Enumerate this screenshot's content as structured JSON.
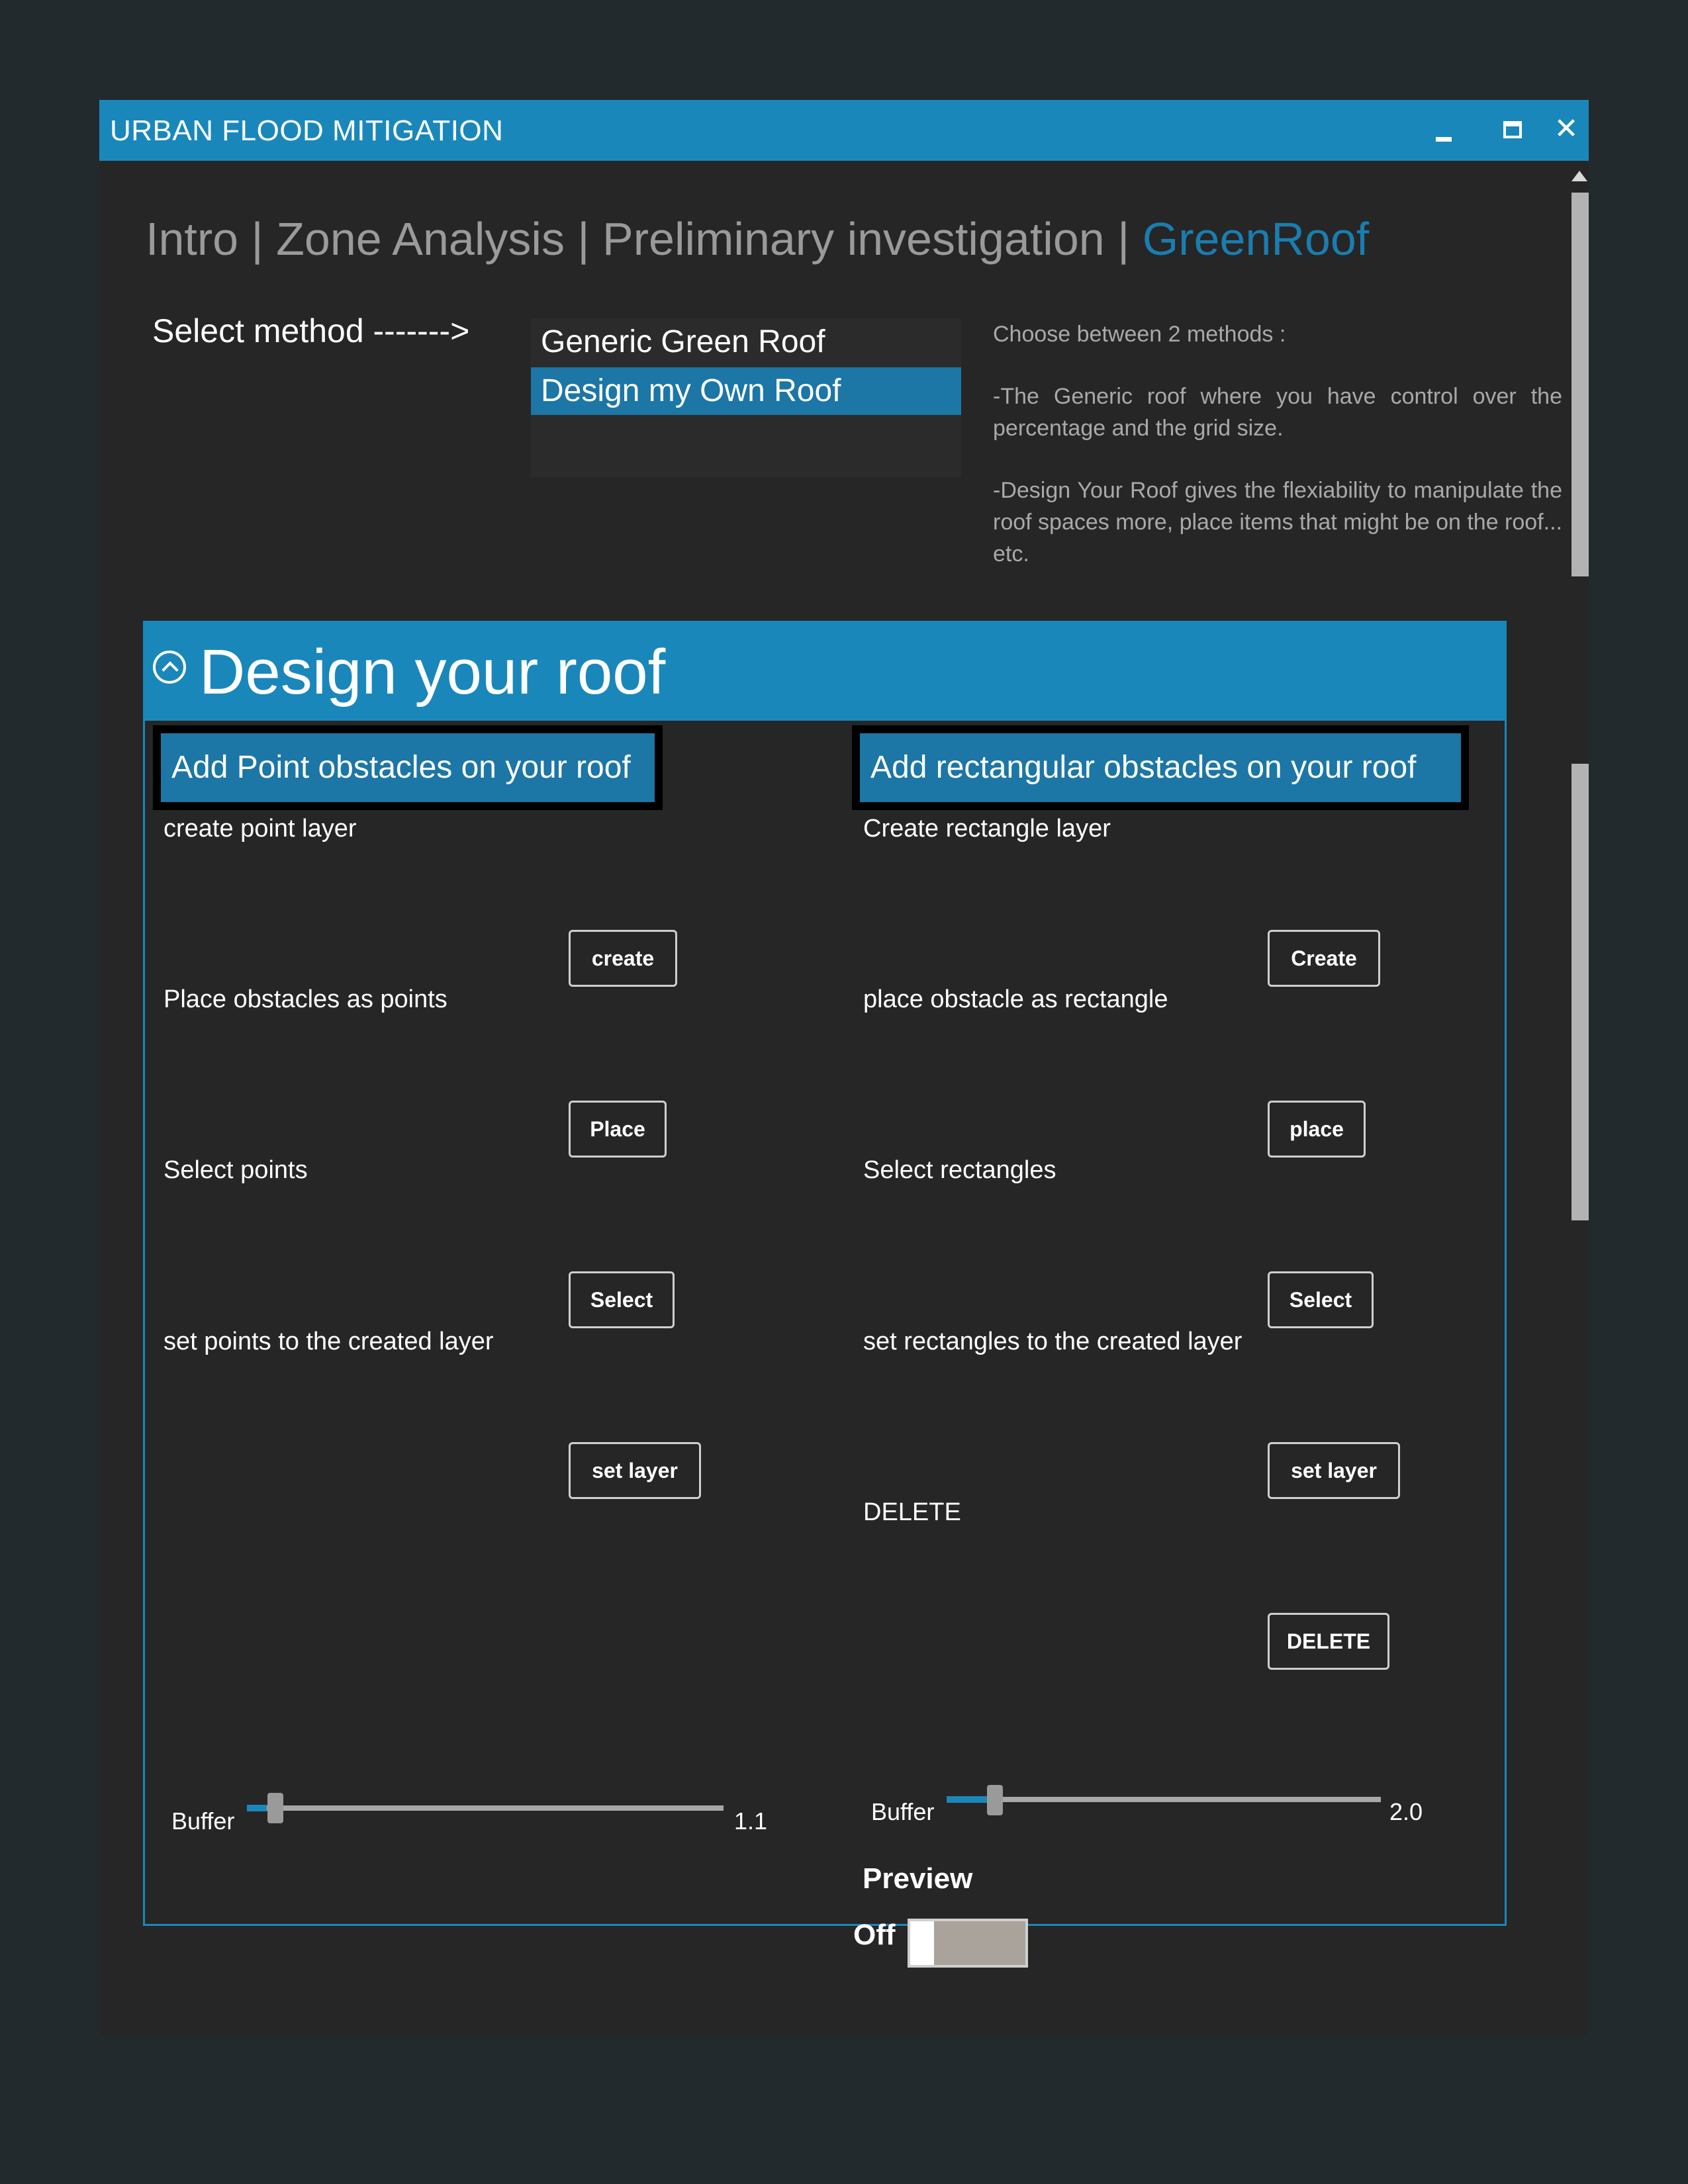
{
  "window": {
    "title": "URBAN FLOOD MITIGATION",
    "controls": [
      "minimize-icon",
      "maximize-icon",
      "close-icon"
    ],
    "close_glyph": "✕"
  },
  "tabs": [
    {
      "label": "Intro |",
      "active": false
    },
    {
      "label": "Zone Analysis |",
      "active": false
    },
    {
      "label": "Preliminary investigation |",
      "active": false
    },
    {
      "label": "GreenRoof",
      "active": true
    }
  ],
  "method": {
    "label": "Select method ------->",
    "options": [
      "Generic Green Roof",
      "Design my Own Roof"
    ],
    "selected": "Design my Own Roof"
  },
  "description": {
    "line1": "Choose between 2 methods :",
    "line2": "-The Generic roof where you have control over the percentage and the grid size.",
    "line3": "-Design Your Roof gives the flexiability to manipulate the roof spaces more, place items that might be on the roof... etc."
  },
  "section": {
    "title": "Design your roof",
    "expanded": true
  },
  "points": {
    "header": "Add Point obstacles on your roof",
    "rows": [
      {
        "label": "create point layer",
        "button": "create"
      },
      {
        "label": "Place obstacles as points",
        "button": "Place"
      },
      {
        "label": "Select points",
        "button": "Select"
      },
      {
        "label": "set points to the created layer",
        "button": "set layer"
      }
    ],
    "buffer": {
      "label": "Buffer",
      "value": "1.1",
      "fraction": 0.03
    }
  },
  "rectangles": {
    "header": "Add rectangular obstacles on your roof",
    "rows": [
      {
        "label": "Create rectangle layer",
        "button": "Create"
      },
      {
        "label": "place obstacle as rectangle",
        "button": "place"
      },
      {
        "label": "Select rectangles",
        "button": "Select"
      },
      {
        "label": "set rectangles to the created layer",
        "button": "set layer"
      },
      {
        "label": "DELETE",
        "button": "DELETE"
      }
    ],
    "buffer": {
      "label": "Buffer",
      "value": "2.0",
      "fraction": 0.11
    }
  },
  "preview": {
    "label": "Preview",
    "state": "Off"
  },
  "colors": {
    "accent": "#1a87bb",
    "selected": "#1c76a6",
    "active_tab": "#1a7db0",
    "background": "#262626"
  }
}
